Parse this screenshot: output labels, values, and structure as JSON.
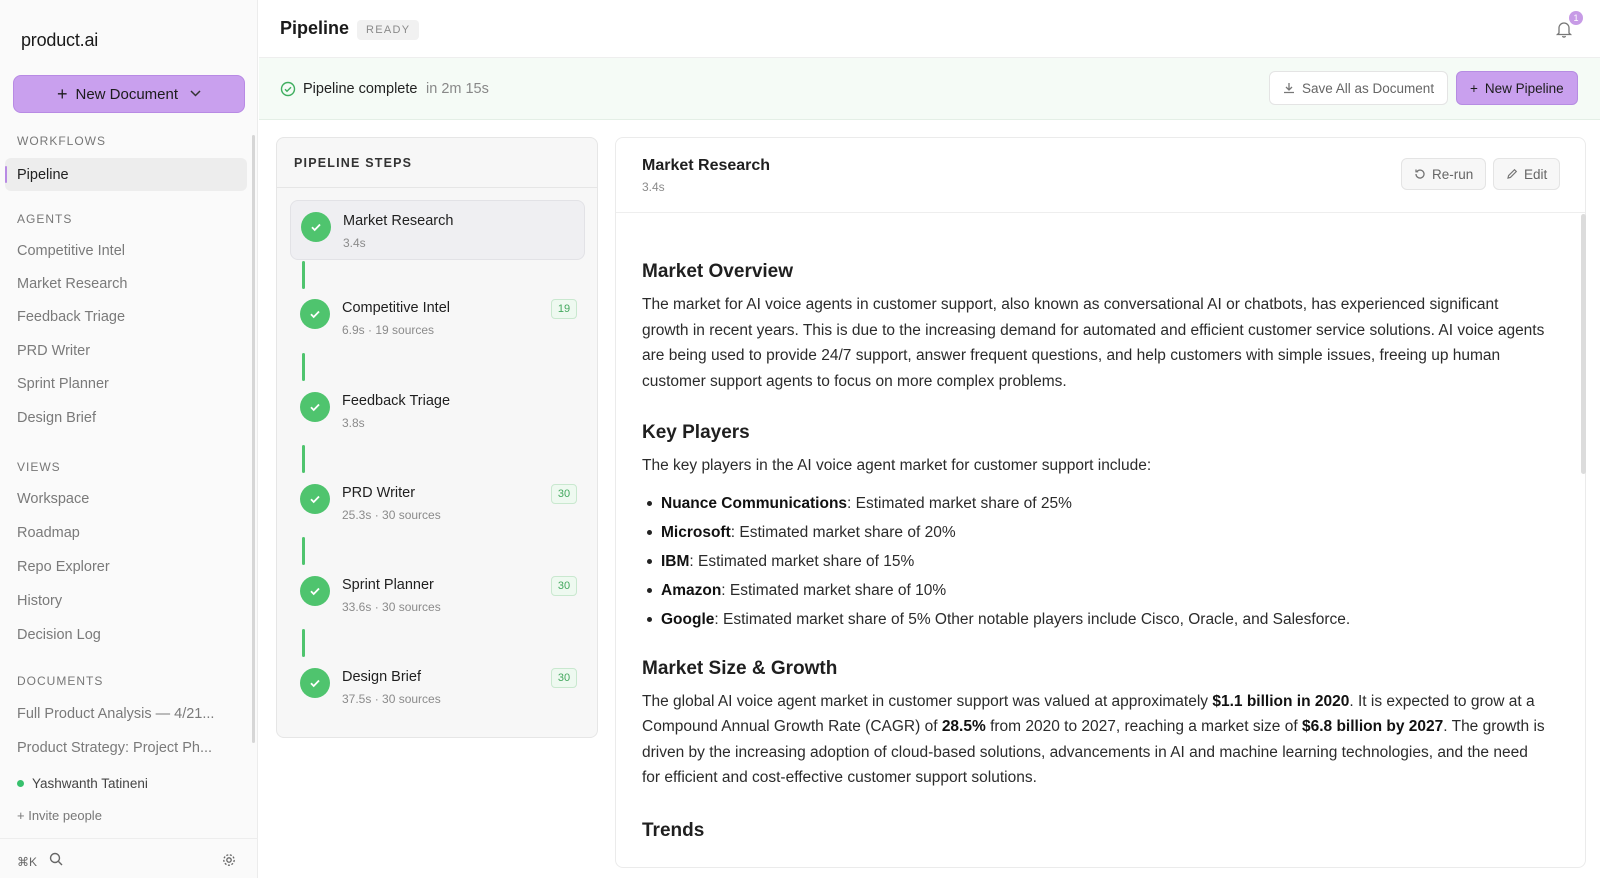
{
  "app": {
    "name": "product.ai"
  },
  "sidebar": {
    "new_document": "New Document",
    "sections": {
      "workflows": "WORKFLOWS",
      "agents": "AGENTS",
      "views": "VIEWS",
      "documents": "DOCUMENTS"
    },
    "workflows": [
      "Pipeline"
    ],
    "agents": [
      "Competitive Intel",
      "Market Research",
      "Feedback Triage",
      "PRD Writer",
      "Sprint Planner",
      "Design Brief"
    ],
    "views": [
      "Workspace",
      "Roadmap",
      "Repo Explorer",
      "History",
      "Decision Log"
    ],
    "documents": [
      "Full Product Analysis — 4/21...",
      "Product Strategy: Project Ph..."
    ],
    "user": "Yashwanth Tatineni",
    "invite": "+ Invite people",
    "shortcut": "⌘K"
  },
  "header": {
    "title": "Pipeline",
    "status": "READY",
    "notifications": "1"
  },
  "status_strip": {
    "message": "Pipeline complete",
    "duration": "in 2m 15s",
    "save_all": "Save All as Document",
    "new_pipeline": "New Pipeline"
  },
  "steps_panel": {
    "title": "PIPELINE STEPS",
    "steps": [
      {
        "name": "Market Research",
        "meta": "3.4s",
        "count": ""
      },
      {
        "name": "Competitive Intel",
        "meta": "6.9s · 19 sources",
        "count": "19"
      },
      {
        "name": "Feedback Triage",
        "meta": "3.8s",
        "count": ""
      },
      {
        "name": "PRD Writer",
        "meta": "25.3s · 30 sources",
        "count": "30"
      },
      {
        "name": "Sprint Planner",
        "meta": "33.6s · 30 sources",
        "count": "30"
      },
      {
        "name": "Design Brief",
        "meta": "37.5s · 30 sources",
        "count": "30"
      }
    ]
  },
  "detail": {
    "title": "Market Research",
    "time": "3.4s",
    "rerun": "Re-run",
    "edit": "Edit",
    "overview_h": "Market Overview",
    "overview_p": "The market for AI voice agents in customer support, also known as conversational AI or chatbots, has experienced significant growth in recent years. This is due to the increasing demand for automated and efficient customer service solutions. AI voice agents are being used to provide 24/7 support, answer frequent questions, and help customers with simple issues, freeing up human customer support agents to focus on more complex problems.",
    "players_h": "Key Players",
    "players_intro": "The key players in the AI voice agent market for customer support include:",
    "players": [
      {
        "name": "Nuance Communications",
        "text": ": Estimated market share of 25%"
      },
      {
        "name": "Microsoft",
        "text": ": Estimated market share of 20%"
      },
      {
        "name": "IBM",
        "text": ": Estimated market share of 15%"
      },
      {
        "name": "Amazon",
        "text": ": Estimated market share of 10%"
      },
      {
        "name": "Google",
        "text": ": Estimated market share of 5% Other notable players include Cisco, Oracle, and Salesforce."
      }
    ],
    "size_h": "Market Size & Growth",
    "size_p1": "The global AI voice agent market in customer support was valued at approximately ",
    "size_b1": "$1.1 billion in 2020",
    "size_p2": ". It is expected to grow at a Compound Annual Growth Rate (CAGR) of ",
    "size_b2": "28.5%",
    "size_p3": " from 2020 to 2027, reaching a market size of ",
    "size_b3": "$6.8 billion by 2027",
    "size_p4": ". The growth is driven by the increasing adoption of cloud-based solutions, advancements in AI and machine learning technologies, and the need for efficient and cost-effective customer support solutions.",
    "trends_h": "Trends"
  }
}
